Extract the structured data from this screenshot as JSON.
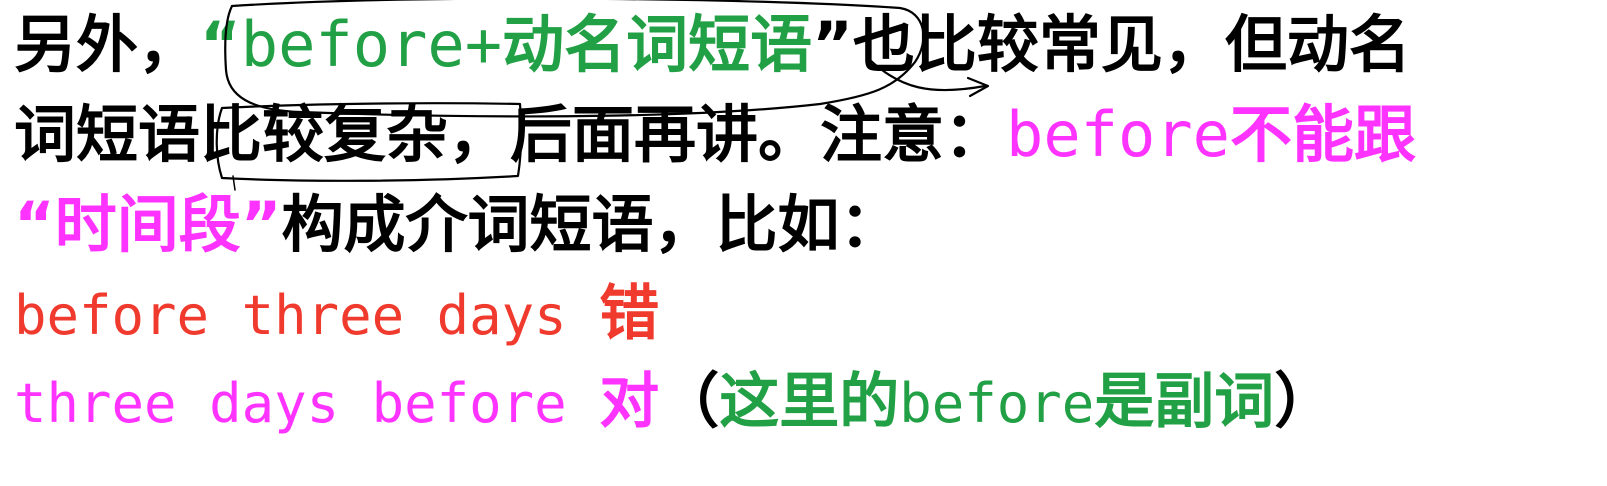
{
  "colors": {
    "black": "#000000",
    "green": "#22a045",
    "magenta": "#ff33ff",
    "red": "#f03a2e"
  },
  "line1": {
    "prefix": "另外，",
    "quoted_open": "“",
    "quoted_en": "before+",
    "quoted_cn": "动名词短语",
    "quoted_close": "”",
    "suffix": "也比较常见，但动名"
  },
  "line2": {
    "prefix": "词短语比较复杂，后面再讲。注意：",
    "note_en": "before",
    "note_cn": "不能跟"
  },
  "line3": {
    "quoted": "“时间段”",
    "suffix": "构成介词短语，比如："
  },
  "line4": {
    "example": "before three days ",
    "verdict": "错"
  },
  "line5": {
    "example": "three days before ",
    "verdict": "对",
    "paren_open": "（",
    "note_cn1": "这里的",
    "note_en": "before",
    "note_cn2": "是副词",
    "paren_close": "）"
  }
}
